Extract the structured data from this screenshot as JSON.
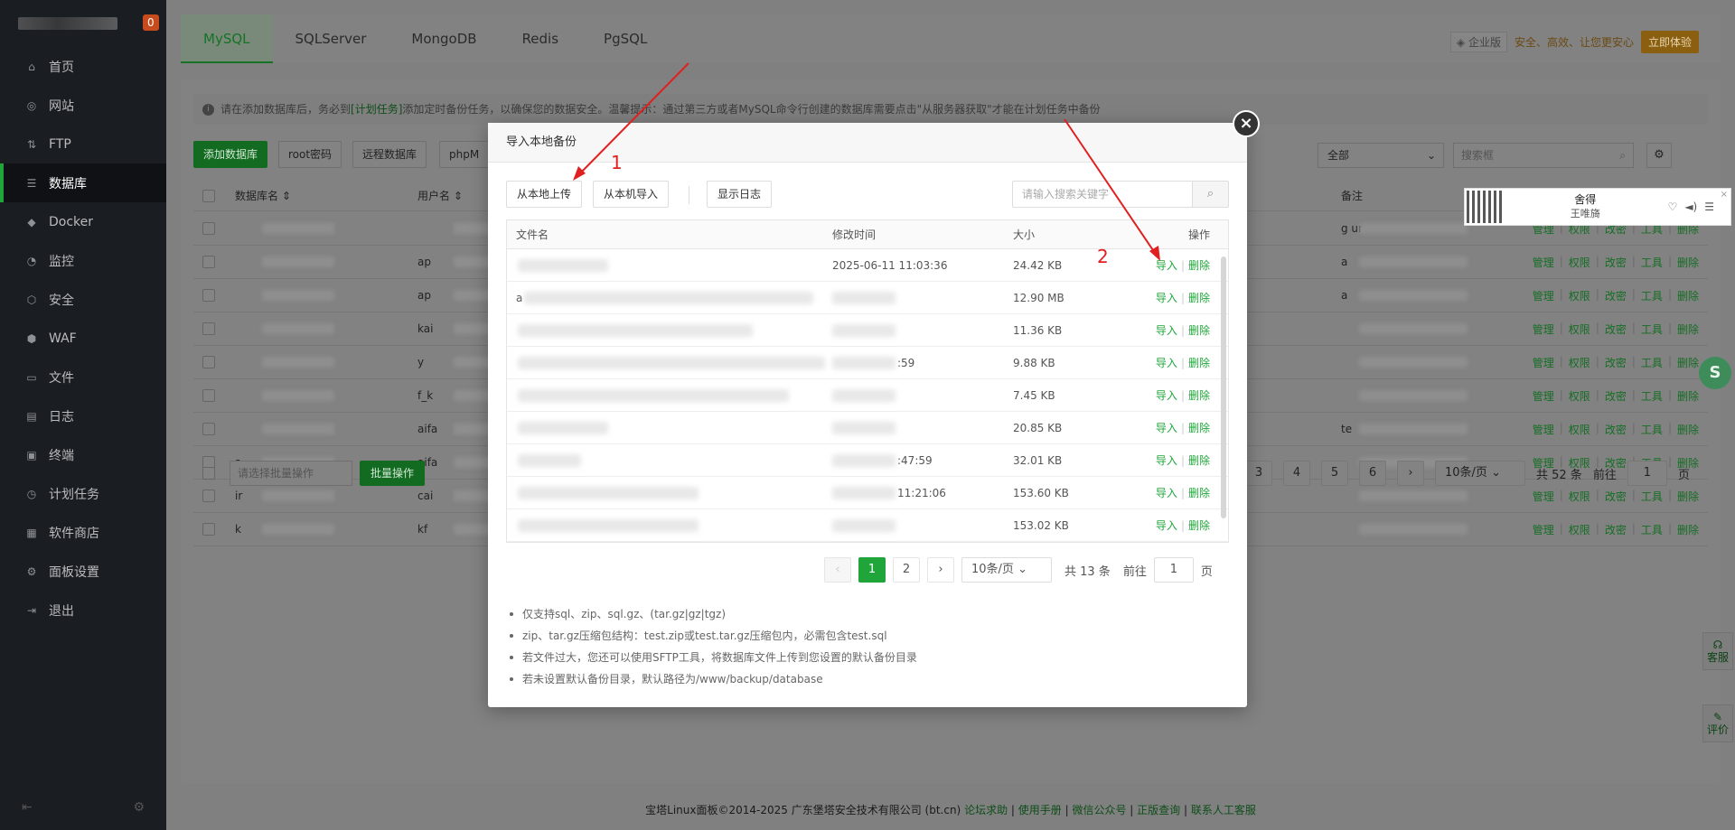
{
  "sidebar": {
    "badge_count": "0",
    "items": [
      {
        "label": "首页",
        "icon": "home-icon",
        "glyph": "⌂"
      },
      {
        "label": "网站",
        "icon": "globe-icon",
        "glyph": "◎"
      },
      {
        "label": "FTP",
        "icon": "ftp-icon",
        "glyph": "⇅"
      },
      {
        "label": "数据库",
        "icon": "database-icon",
        "glyph": "☰"
      },
      {
        "label": "Docker",
        "icon": "docker-icon",
        "glyph": "◆"
      },
      {
        "label": "监控",
        "icon": "monitor-icon",
        "glyph": "◔"
      },
      {
        "label": "安全",
        "icon": "shield-icon",
        "glyph": "⬡"
      },
      {
        "label": "WAF",
        "icon": "waf-icon",
        "glyph": "⬢"
      },
      {
        "label": "文件",
        "icon": "folder-icon",
        "glyph": "▭"
      },
      {
        "label": "日志",
        "icon": "log-icon",
        "glyph": "▤"
      },
      {
        "label": "终端",
        "icon": "terminal-icon",
        "glyph": "▣"
      },
      {
        "label": "计划任务",
        "icon": "clock-icon",
        "glyph": "◷"
      },
      {
        "label": "软件商店",
        "icon": "store-icon",
        "glyph": "▦"
      },
      {
        "label": "面板设置",
        "icon": "settings-icon",
        "glyph": "⚙"
      },
      {
        "label": "退出",
        "icon": "logout-icon",
        "glyph": "⇥"
      }
    ],
    "active_index": 3
  },
  "tabs": [
    "MySQL",
    "SQLServer",
    "MongoDB",
    "Redis",
    "PgSQL"
  ],
  "enterprise": {
    "tag": "企业版",
    "text": "安全、高效、让您更安心",
    "button": "立即体验"
  },
  "tip": {
    "before": "请在添加数据库后，务必到",
    "link": "[计划任务]",
    "after": "添加定时备份任务，以确保您的数据安全。温馨提示：通过第三方或者MySQL命令行创建的数据库需要点击\"从服务器获取\"才能在计划任务中备份"
  },
  "toolbar": {
    "add_db": "添加数据库",
    "root_pwd": "root密码",
    "remote_db": "远程数据库",
    "phpmyadmin": "phpM",
    "filter_select": "全部",
    "search_placeholder": "搜索框"
  },
  "table": {
    "col_name": "数据库名",
    "col_user": "用户名",
    "col_note": "备注",
    "ops": [
      "管理",
      "权限",
      "改密",
      "工具",
      "删除"
    ],
    "user_fragments": [
      "",
      "ap",
      "ap",
      "kai",
      "y",
      "f_k",
      "aifa",
      "aifa",
      "cai",
      "kf"
    ],
    "name_fragments": [
      "",
      "",
      "",
      "",
      "",
      "",
      "",
      "s",
      "ir",
      "k"
    ],
    "note_fragments": [
      "g  ur",
      "a",
      "a",
      "",
      "",
      "",
      "te",
      "",
      "",
      ""
    ],
    "batch_placeholder": "请选择批量操作",
    "batch_button": "批量操作"
  },
  "main_pager": {
    "pages": [
      "3",
      "4",
      "5",
      "6"
    ],
    "size": "10条/页",
    "total": "共 52 条",
    "goto_label": "前往",
    "goto_value": "1",
    "page_unit": "页"
  },
  "music_widget": {
    "title": "舍得",
    "artist": "王唯旖"
  },
  "side_feedback": {
    "service": "客服",
    "review": "评价"
  },
  "footer": {
    "copyright": "宝塔Linux面板©2014-2025 广东堡塔安全技术有限公司 (bt.cn)",
    "links": [
      "论坛求助",
      "使用手册",
      "微信公众号",
      "正版查询",
      "联系人工客服"
    ]
  },
  "modal": {
    "title": "导入本地备份",
    "btn_upload": "从本地上传",
    "btn_import_local": "从本机导入",
    "btn_show_log": "显示日志",
    "search_placeholder": "请输入搜索关键字",
    "col_name": "文件名",
    "col_time": "修改时间",
    "col_size": "大小",
    "col_ops": "操作",
    "op_import": "导入",
    "op_delete": "删除",
    "rows": [
      {
        "name": "",
        "time": "2025-06-11 11:03:36",
        "size": "24.42 KB"
      },
      {
        "name": "a",
        "time": "",
        "size": "12.90 MB"
      },
      {
        "name": "",
        "time": "",
        "size": "11.36 KB"
      },
      {
        "name": "",
        "time": ":59",
        "size": "9.88 KB"
      },
      {
        "name": "",
        "time": "",
        "size": "7.45 KB"
      },
      {
        "name": "",
        "time": "",
        "size": "20.85 KB"
      },
      {
        "name": "",
        "time": ":47:59",
        "size": "32.01 KB"
      },
      {
        "name": "",
        "time": "11:21:06",
        "size": "153.60 KB"
      },
      {
        "name": "",
        "time": "",
        "size": "153.02 KB"
      }
    ],
    "pager": {
      "pages": [
        "1",
        "2"
      ],
      "current": "1",
      "size": "10条/页",
      "total": "共 13 条",
      "goto_label": "前往",
      "goto_value": "1",
      "page_unit": "页"
    },
    "notes": [
      "仅支持sql、zip、sql.gz、(tar.gz|gz|tgz)",
      "zip、tar.gz压缩包结构：test.zip或test.tar.gz压缩包内，必需包含test.sql",
      "若文件过大，您还可以使用SFTP工具，将数据库文件上传到您设置的默认备份目录",
      "若未设置默认备份目录，默认路径为/www/backup/database"
    ]
  },
  "annotations": {
    "label_1": "1",
    "label_2": "2",
    "color": "#e02020"
  }
}
